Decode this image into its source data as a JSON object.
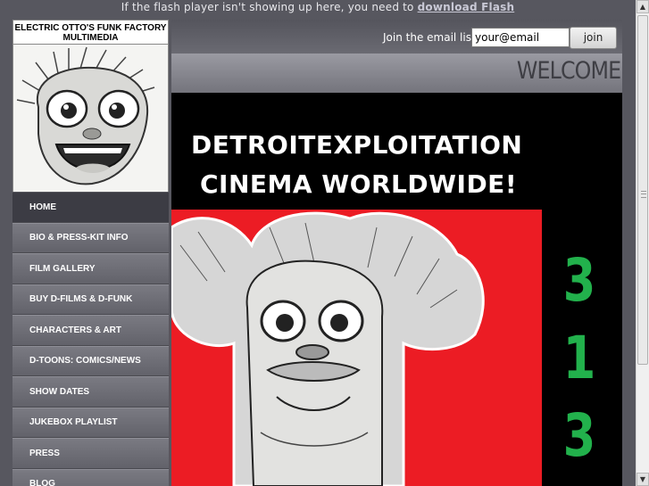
{
  "flash_notice": {
    "text": "If the flash player isn't showing up here, you need to ",
    "link": "download Flash"
  },
  "logo": {
    "line1": "ELECTRIC OTTO'S FUNK FACTORY",
    "line2": "MULTIMEDIA"
  },
  "nav": {
    "items": [
      {
        "label": "HOME",
        "active": true
      },
      {
        "label": "BIO & PRESS-KIT INFO"
      },
      {
        "label": "FILM GALLERY"
      },
      {
        "label": "BUY D-FILMS & D-FUNK"
      },
      {
        "label": "CHARACTERS & ART"
      },
      {
        "label": "D-TOONS: COMICS/NEWS"
      },
      {
        "label": "SHOW DATES"
      },
      {
        "label": "JUKEBOX PLAYLIST"
      },
      {
        "label": "PRESS"
      },
      {
        "label": "BLOG"
      }
    ]
  },
  "email": {
    "label": "Join the email list!",
    "value": "your@email",
    "button": "join"
  },
  "welcome": "WELCOME",
  "poster": {
    "line1": "DETROITEXPLOITATION",
    "line2": "CINEMA WORLDWIDE!",
    "digits": [
      "3",
      "1",
      "3"
    ]
  },
  "colors": {
    "background": "#57575f",
    "poster_red": "#ec1c24",
    "poster_green": "#22b14c"
  }
}
